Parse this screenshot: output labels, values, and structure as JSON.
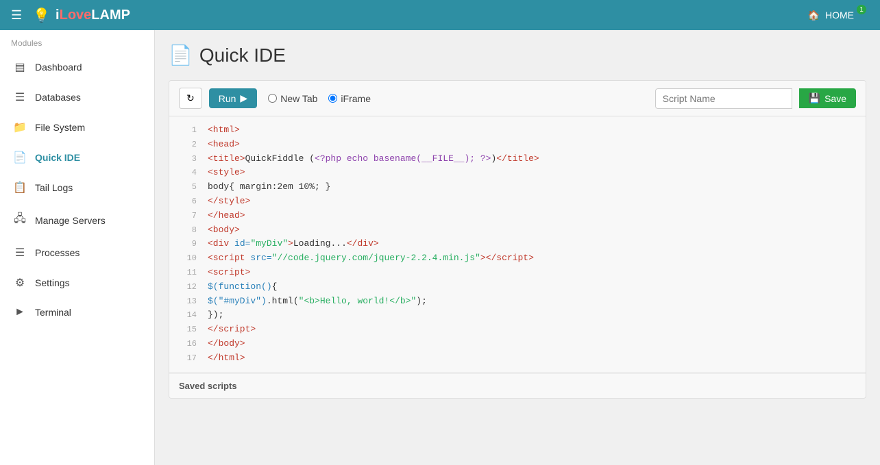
{
  "navbar": {
    "brand": "iLoveLAMP",
    "brand_i": "i",
    "brand_love": "Love",
    "brand_lamp": "LAMP",
    "home_label": "HOME",
    "home_badge": "1"
  },
  "sidebar": {
    "section_label": "Modules",
    "items": [
      {
        "id": "dashboard",
        "label": "Dashboard",
        "icon": "▣"
      },
      {
        "id": "databases",
        "label": "Databases",
        "icon": "☰"
      },
      {
        "id": "filesystem",
        "label": "File System",
        "icon": "📁"
      },
      {
        "id": "quickide",
        "label": "Quick IDE",
        "icon": "📄",
        "active": true
      },
      {
        "id": "taillogs",
        "label": "Tail Logs",
        "icon": "📋"
      },
      {
        "id": "manageservers",
        "label": "Manage Servers",
        "icon": "🖧"
      },
      {
        "id": "processes",
        "label": "Processes",
        "icon": "☰"
      },
      {
        "id": "settings",
        "label": "Settings",
        "icon": "⚙"
      },
      {
        "id": "terminal",
        "label": "Terminal",
        "icon": ">"
      }
    ]
  },
  "page": {
    "title": "Quick IDE",
    "icon": "📄"
  },
  "toolbar": {
    "run_label": "Run",
    "new_tab_label": "New Tab",
    "iframe_label": "iFrame",
    "script_name_placeholder": "Script Name",
    "save_label": "Save"
  },
  "code": {
    "lines": [
      {
        "num": 1,
        "html": "<span class='tag'>&lt;html&gt;</span>"
      },
      {
        "num": 2,
        "html": "<span class='tag'>&lt;head&gt;</span>"
      },
      {
        "num": 3,
        "html": "<span class='tag'>&lt;title&gt;</span><span class='plain'>QuickFiddle (</span><span class='php'>&lt;?php echo basename(__FILE__); ?&gt;</span><span class='plain'>)</span><span class='tag'>&lt;/title&gt;</span>"
      },
      {
        "num": 4,
        "html": "<span class='tag'>&lt;style&gt;</span>"
      },
      {
        "num": 5,
        "html": "<span class='plain'>    body{ margin:2em 10%; }</span>"
      },
      {
        "num": 6,
        "html": "<span class='tag'>&lt;/style&gt;</span>"
      },
      {
        "num": 7,
        "html": "<span class='tag'>&lt;/head&gt;</span>"
      },
      {
        "num": 8,
        "html": "<span class='tag'>&lt;body&gt;</span>"
      },
      {
        "num": 9,
        "html": "    <span class='tag'>&lt;div</span> <span class='attr-name'>id=</span><span class='attr-val'>\"myDiv\"</span><span class='tag'>&gt;</span><span class='plain'>Loading...</span><span class='tag'>&lt;/div&gt;</span>"
      },
      {
        "num": 10,
        "html": "    <span class='tag'>&lt;script</span> <span class='attr-name'>src=</span><span class='attr-val'>\"//code.jquery.com/jquery-2.2.4.min.js\"</span><span class='tag'>&gt;&lt;/script&gt;</span>"
      },
      {
        "num": 11,
        "html": "    <span class='tag'>&lt;script&gt;</span>"
      },
      {
        "num": 12,
        "html": "        <span class='func'>$(function()</span><span class='plain'>{</span>"
      },
      {
        "num": 13,
        "html": "            <span class='func'>$(\"#myDiv\")</span><span class='plain'>.html(</span><span class='str'>\"&lt;b&gt;Hello, world!&lt;/b&gt;\"</span><span class='plain'>);</span>"
      },
      {
        "num": 14,
        "html": "        <span class='plain'>});</span>"
      },
      {
        "num": 15,
        "html": "    <span class='tag'>&lt;/script&gt;</span>"
      },
      {
        "num": 16,
        "html": "    <span class='tag'>&lt;/body&gt;</span>"
      },
      {
        "num": 17,
        "html": "<span class='tag'>&lt;/html&gt;</span>"
      }
    ]
  },
  "saved_scripts": {
    "label": "Saved scripts"
  }
}
